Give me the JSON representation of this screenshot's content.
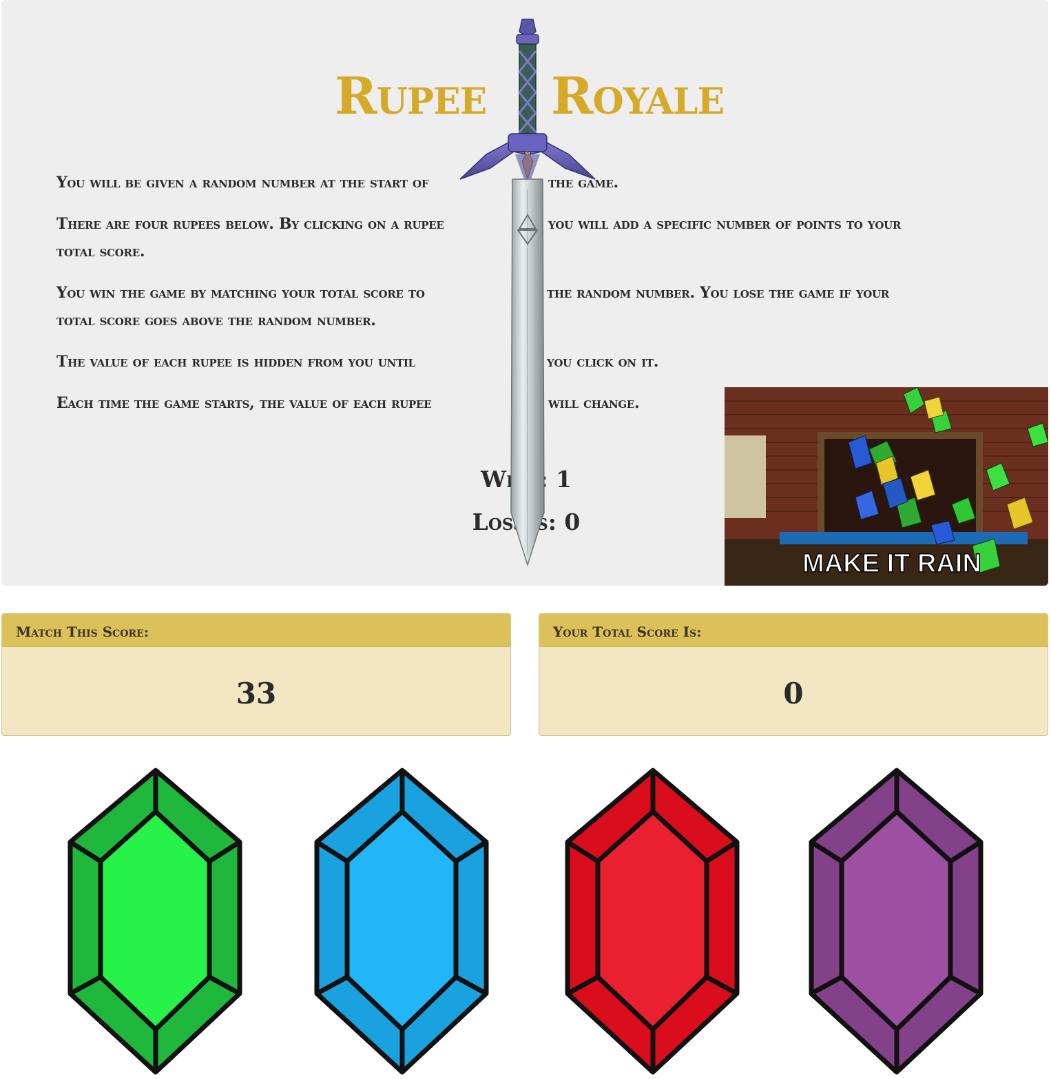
{
  "header": {
    "title_word1": "Rupee",
    "title_word2": "Royale"
  },
  "instructions": [
    {
      "left": "You will be given a random number at the start of",
      "right": "the game."
    },
    {
      "left": "There are four rupees below. By clicking on a rupee",
      "right": "you will add a specific number of points to your",
      "wrap": "total score."
    },
    {
      "left": "You win the game by matching your total score to",
      "right": "the random number. You lose the game if your",
      "wrap": "total score goes above the random number."
    },
    {
      "left": "The value of each rupee is hidden from you until",
      "right": "you click on it."
    },
    {
      "left": "Each time the game starts, the value of each rupee",
      "right": "will change."
    }
  ],
  "stats": {
    "wins_label": "Wins: 1",
    "losses_label": "Losses: 0"
  },
  "gif": {
    "caption": "MAKE IT RAIN"
  },
  "target_panel": {
    "heading": "Match This Score:",
    "value": "33"
  },
  "total_panel": {
    "heading": "Your Total Score Is:",
    "value": "0"
  },
  "rupees": [
    {
      "color_name": "green",
      "outer": "#1fb83c",
      "inner": "#27f24a"
    },
    {
      "color_name": "blue",
      "outer": "#1aa2e0",
      "inner": "#22b6f8"
    },
    {
      "color_name": "red",
      "outer": "#d90d1c",
      "inner": "#ea2030"
    },
    {
      "color_name": "purple",
      "outer": "#83418a",
      "inner": "#9d4fa2"
    }
  ]
}
